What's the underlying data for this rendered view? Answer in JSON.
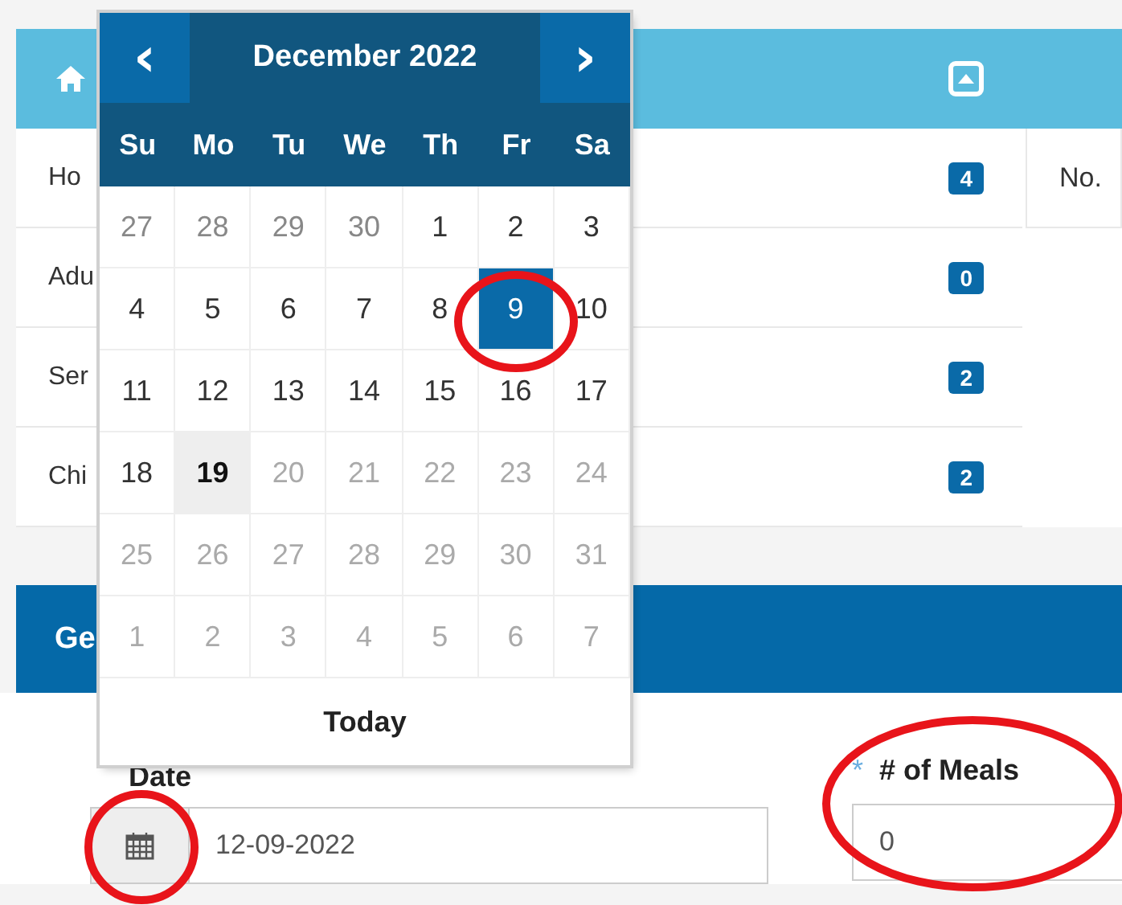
{
  "summary_panel": {
    "rows": [
      {
        "label": "Ho",
        "count": "4"
      },
      {
        "label": "Adu",
        "count": "0"
      },
      {
        "label": "Ser",
        "count": "2"
      },
      {
        "label": "Chi",
        "count": "2"
      }
    ],
    "side_panel": {
      "label": "No."
    }
  },
  "section": {
    "title": "Ge"
  },
  "form": {
    "date": {
      "label": "Date",
      "value": "12-09-2022"
    },
    "meals": {
      "required_mark": "*",
      "label": "# of Meals",
      "value": "0"
    }
  },
  "datepicker": {
    "prev": "‹",
    "title": "December 2022",
    "next": "›",
    "weekdays": [
      "Su",
      "Mo",
      "Tu",
      "We",
      "Th",
      "Fr",
      "Sa"
    ],
    "days": [
      {
        "label": "27",
        "kind": "old",
        "selected": false
      },
      {
        "label": "28",
        "kind": "old",
        "selected": false
      },
      {
        "label": "29",
        "kind": "old",
        "selected": false
      },
      {
        "label": "30",
        "kind": "old",
        "selected": false
      },
      {
        "label": "1",
        "kind": "day",
        "selected": false
      },
      {
        "label": "2",
        "kind": "day",
        "selected": false
      },
      {
        "label": "3",
        "kind": "day",
        "selected": false
      },
      {
        "label": "4",
        "kind": "day",
        "selected": false
      },
      {
        "label": "5",
        "kind": "day",
        "selected": false
      },
      {
        "label": "6",
        "kind": "day",
        "selected": false
      },
      {
        "label": "7",
        "kind": "day",
        "selected": false
      },
      {
        "label": "8",
        "kind": "day",
        "selected": false
      },
      {
        "label": "9",
        "kind": "day",
        "selected": true
      },
      {
        "label": "10",
        "kind": "day",
        "selected": false
      },
      {
        "label": "11",
        "kind": "day",
        "selected": false
      },
      {
        "label": "12",
        "kind": "day",
        "selected": false
      },
      {
        "label": "13",
        "kind": "day",
        "selected": false
      },
      {
        "label": "14",
        "kind": "day",
        "selected": false
      },
      {
        "label": "15",
        "kind": "day",
        "selected": false
      },
      {
        "label": "16",
        "kind": "day",
        "selected": false
      },
      {
        "label": "17",
        "kind": "day",
        "selected": false
      },
      {
        "label": "18",
        "kind": "day",
        "selected": false
      },
      {
        "label": "19",
        "kind": "today",
        "selected": false
      },
      {
        "label": "20",
        "kind": "disabled",
        "selected": false
      },
      {
        "label": "21",
        "kind": "disabled",
        "selected": false
      },
      {
        "label": "22",
        "kind": "disabled",
        "selected": false
      },
      {
        "label": "23",
        "kind": "disabled",
        "selected": false
      },
      {
        "label": "24",
        "kind": "disabled",
        "selected": false
      },
      {
        "label": "25",
        "kind": "disabled",
        "selected": false
      },
      {
        "label": "26",
        "kind": "disabled",
        "selected": false
      },
      {
        "label": "27",
        "kind": "disabled",
        "selected": false
      },
      {
        "label": "28",
        "kind": "disabled",
        "selected": false
      },
      {
        "label": "29",
        "kind": "disabled",
        "selected": false
      },
      {
        "label": "30",
        "kind": "disabled",
        "selected": false
      },
      {
        "label": "31",
        "kind": "disabled",
        "selected": false
      },
      {
        "label": "1",
        "kind": "disabled",
        "selected": false
      },
      {
        "label": "2",
        "kind": "disabled",
        "selected": false
      },
      {
        "label": "3",
        "kind": "disabled",
        "selected": false
      },
      {
        "label": "4",
        "kind": "disabled",
        "selected": false
      },
      {
        "label": "5",
        "kind": "disabled",
        "selected": false
      },
      {
        "label": "6",
        "kind": "disabled",
        "selected": false
      },
      {
        "label": "7",
        "kind": "disabled",
        "selected": false
      }
    ],
    "today_button": "Today"
  }
}
